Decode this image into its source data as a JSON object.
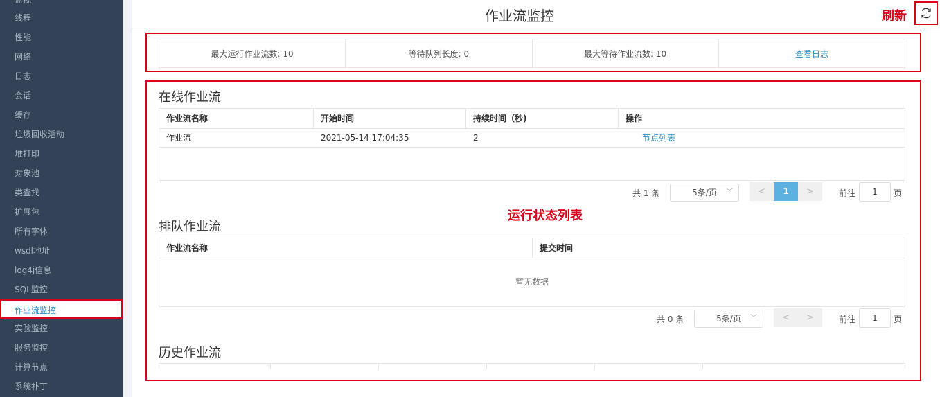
{
  "sidebar": {
    "items": [
      {
        "label": "监视"
      },
      {
        "label": "线程"
      },
      {
        "label": "性能"
      },
      {
        "label": "网络"
      },
      {
        "label": "日志"
      },
      {
        "label": "会话"
      },
      {
        "label": "缓存"
      },
      {
        "label": "垃圾回收活动"
      },
      {
        "label": "堆打印"
      },
      {
        "label": "对象池"
      },
      {
        "label": "类查找"
      },
      {
        "label": "扩展包"
      },
      {
        "label": "所有字体"
      },
      {
        "label": "wsdl地址"
      },
      {
        "label": "log4j信息"
      },
      {
        "label": "SQL监控"
      },
      {
        "label": "作业流监控"
      },
      {
        "label": "实验监控"
      },
      {
        "label": "服务监控"
      },
      {
        "label": "计算节点"
      },
      {
        "label": "系统补丁"
      }
    ],
    "active_index": 16
  },
  "header": {
    "title": "作业流监控",
    "refresh_annotation": "刷新",
    "refresh_icon": "refresh-icon"
  },
  "stats": {
    "max_running": "最大运行作业流数: 10",
    "queue_length": "等待队列长度: 0",
    "max_waiting": "最大等待作业流数: 10",
    "view_log": "查看日志"
  },
  "annotation": {
    "status_list": "运行状态列表"
  },
  "online": {
    "title": "在线作业流",
    "columns": [
      "作业流名称",
      "开始时间",
      "持续时间（秒)",
      "操作"
    ],
    "rows": [
      {
        "name": "作业流",
        "start": "2021-05-14 17:04:35",
        "duration": "2",
        "action": "节点列表"
      }
    ],
    "pager": {
      "total": "共 1 条",
      "page_size": "5条/页",
      "current_page": "1",
      "goto_label": "前往",
      "goto_value": "1",
      "page_suffix": "页"
    }
  },
  "queued": {
    "title": "排队作业流",
    "columns": [
      "作业流名称",
      "提交时间"
    ],
    "empty_text": "暂无数据",
    "pager": {
      "total": "共 0 条",
      "page_size": "5条/页",
      "goto_label": "前往",
      "goto_value": "1",
      "page_suffix": "页"
    }
  },
  "history": {
    "title": "历史作业流"
  },
  "colors": {
    "sidebar_bg": "#334257",
    "accent": "#2d8cc0",
    "annotation_red": "#d9001b",
    "page_active": "#5cb1e0"
  }
}
